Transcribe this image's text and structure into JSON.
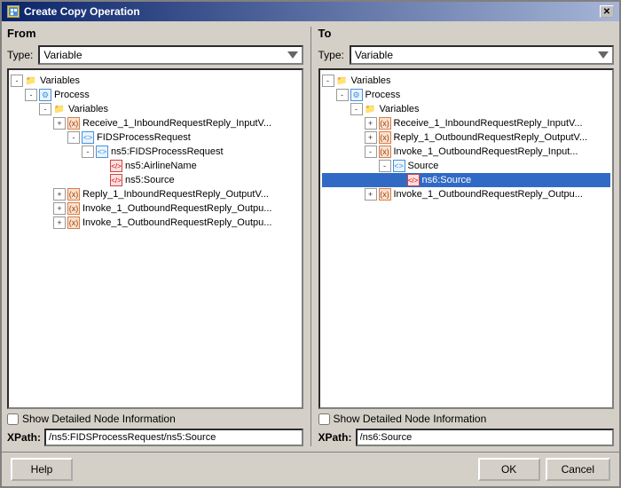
{
  "window": {
    "title": "Create Copy Operation",
    "close_label": "✕"
  },
  "from_panel": {
    "title": "From",
    "type_label": "Type:",
    "type_value": "Variable",
    "tree": [
      {
        "id": "f-vars",
        "label": "Variables",
        "indent": 0,
        "icon": "folder",
        "expanded": true,
        "expand": "-"
      },
      {
        "id": "f-process",
        "label": "Process",
        "indent": 1,
        "icon": "process",
        "expanded": true,
        "expand": "-"
      },
      {
        "id": "f-variables2",
        "label": "Variables",
        "indent": 2,
        "icon": "folder",
        "expanded": true,
        "expand": "-"
      },
      {
        "id": "f-receive",
        "label": "Receive_1_InboundRequestReply_InputV...",
        "indent": 3,
        "icon": "variable",
        "expanded": false,
        "expand": "+"
      },
      {
        "id": "f-fids",
        "label": "FIDSProcessRequest",
        "indent": 4,
        "icon": "element",
        "expanded": true,
        "expand": "-"
      },
      {
        "id": "f-ns5fids",
        "label": "ns5:FIDSProcessRequest",
        "indent": 5,
        "icon": "element",
        "expanded": true,
        "expand": "-"
      },
      {
        "id": "f-airline",
        "label": "ns5:AirlineName",
        "indent": 6,
        "icon": "attr",
        "expanded": false,
        "expand": "leaf"
      },
      {
        "id": "f-source",
        "label": "ns5:Source",
        "indent": 6,
        "icon": "attr",
        "expanded": false,
        "expand": "leaf",
        "selected": false
      },
      {
        "id": "f-reply",
        "label": "Reply_1_InboundRequestReply_OutputV...",
        "indent": 3,
        "icon": "variable",
        "expanded": false,
        "expand": "+"
      },
      {
        "id": "f-invoke1",
        "label": "Invoke_1_OutboundRequestReply_Outpu...",
        "indent": 3,
        "icon": "variable",
        "expanded": false,
        "expand": "+"
      },
      {
        "id": "f-invoke2",
        "label": "Invoke_1_OutboundRequestReply_Outpu...",
        "indent": 3,
        "icon": "variable",
        "expanded": false,
        "expand": "+"
      }
    ],
    "show_detailed": "Show Detailed Node Information",
    "xpath_label": "XPath:",
    "xpath_value": "/ns5:FIDSProcessRequest/ns5:Source"
  },
  "to_panel": {
    "title": "To",
    "type_label": "Type:",
    "type_value": "Variable",
    "tree": [
      {
        "id": "t-vars",
        "label": "Variables",
        "indent": 0,
        "icon": "folder",
        "expanded": true,
        "expand": "-"
      },
      {
        "id": "t-process",
        "label": "Process",
        "indent": 1,
        "icon": "process",
        "expanded": true,
        "expand": "-"
      },
      {
        "id": "t-variables2",
        "label": "Variables",
        "indent": 2,
        "icon": "folder",
        "expanded": true,
        "expand": "-"
      },
      {
        "id": "t-receive",
        "label": "Receive_1_InboundRequestReply_InputV...",
        "indent": 3,
        "icon": "variable",
        "expanded": false,
        "expand": "+"
      },
      {
        "id": "t-reply",
        "label": "Reply_1_OutboundRequestReply_OutputV...",
        "indent": 3,
        "icon": "variable",
        "expanded": false,
        "expand": "+"
      },
      {
        "id": "t-invoke1input",
        "label": "Invoke_1_OutboundRequestReply_Input...",
        "indent": 3,
        "icon": "variable",
        "expanded": true,
        "expand": "-"
      },
      {
        "id": "t-source-elem",
        "label": "Source",
        "indent": 4,
        "icon": "element",
        "expanded": true,
        "expand": "-"
      },
      {
        "id": "t-ns6source",
        "label": "ns6:Source",
        "indent": 5,
        "icon": "attr",
        "expanded": false,
        "expand": "leaf",
        "selected": true
      },
      {
        "id": "t-invoke1output",
        "label": "Invoke_1_OutboundRequestReply_Outpu...",
        "indent": 3,
        "icon": "variable",
        "expanded": false,
        "expand": "+"
      }
    ],
    "show_detailed": "Show Detailed Node Information",
    "xpath_label": "XPath:",
    "xpath_value": "/ns6:Source"
  },
  "footer": {
    "help_label": "Help",
    "ok_label": "OK",
    "cancel_label": "Cancel"
  }
}
